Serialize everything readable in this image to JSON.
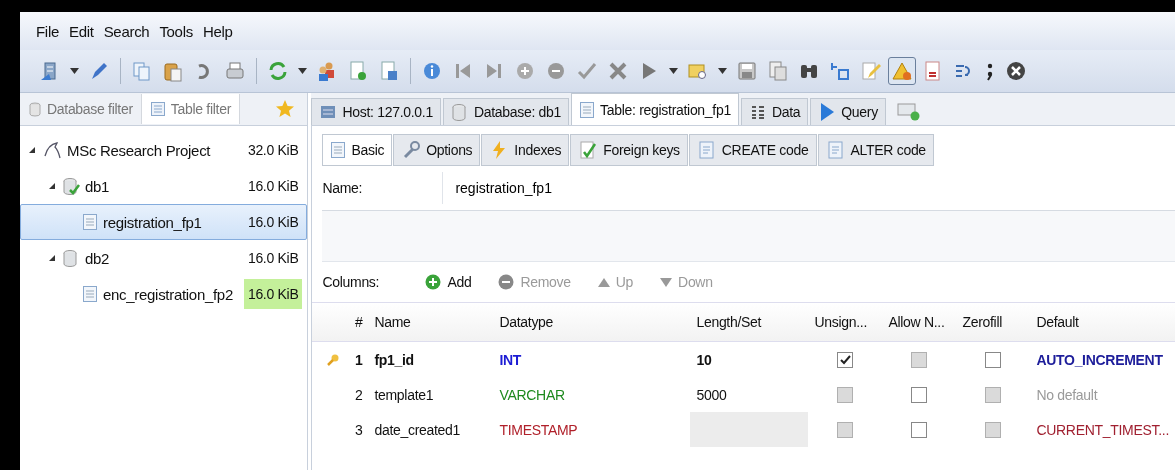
{
  "menu": [
    "File",
    "Edit",
    "Search",
    "Tools",
    "Help"
  ],
  "toolbar_buttons": [
    {
      "pressed": false
    },
    {
      "pressed": false
    },
    {
      "pressed": false
    },
    {
      "pressed": false
    },
    {
      "pressed": false
    },
    {
      "pressed": false
    },
    {
      "pressed": false
    },
    {
      "pressed": false
    },
    {
      "pressed": false
    },
    {
      "pressed": false
    },
    {
      "pressed": false
    },
    {
      "pressed": false
    },
    {
      "pressed": false
    },
    {
      "pressed": false
    },
    {
      "pressed": false
    },
    {
      "pressed": false
    },
    {
      "pressed": false
    },
    {
      "pressed": false
    },
    {
      "pressed": false
    },
    {
      "pressed": false
    },
    {
      "pressed": false
    },
    {
      "pressed": false
    },
    {
      "pressed": false
    },
    {
      "pressed": false
    },
    {
      "pressed": false
    },
    {
      "pressed": false
    },
    {
      "pressed": false
    },
    {
      "pressed": false
    },
    {
      "pressed": true
    },
    {
      "pressed": false
    },
    {
      "pressed": false
    },
    {
      "pressed": false
    },
    {
      "pressed": false
    }
  ],
  "filter_tabs": [
    {
      "label": "Database filter",
      "kind": "database",
      "selected": false
    },
    {
      "label": "Table filter",
      "kind": "table",
      "selected": true
    }
  ],
  "tree": [
    {
      "label": "MSc Research Project",
      "size": "32.0 KiB",
      "kind": "server",
      "expanded": true,
      "selected": false,
      "size_highlighted": false,
      "children": [
        {
          "label": "db1",
          "size": "16.0 KiB",
          "kind": "database-active",
          "expanded": true,
          "selected": false,
          "size_highlighted": false,
          "children": [
            {
              "label": "registration_fp1",
              "size": "16.0 KiB",
              "kind": "table",
              "selected": true,
              "size_highlighted": false
            }
          ]
        },
        {
          "label": "db2",
          "size": "16.0 KiB",
          "kind": "database",
          "expanded": true,
          "selected": false,
          "size_highlighted": false,
          "children": [
            {
              "label": "enc_registration_fp2",
              "size": "16.0 KiB",
              "kind": "table",
              "selected": false,
              "size_highlighted": true
            }
          ]
        }
      ]
    }
  ],
  "tabs": [
    {
      "label": "Host: 127.0.0.1",
      "kind": "host",
      "selected": false
    },
    {
      "label": "Database: db1",
      "kind": "database",
      "selected": false
    },
    {
      "label": "Table: registration_fp1",
      "kind": "table",
      "selected": true
    },
    {
      "label": "Data",
      "kind": "data",
      "selected": false
    },
    {
      "label": "Query",
      "kind": "query",
      "selected": false
    }
  ],
  "editor_tabs": [
    {
      "label": "Basic",
      "kind": "basic",
      "selected": true
    },
    {
      "label": "Options",
      "kind": "options",
      "selected": false
    },
    {
      "label": "Indexes",
      "kind": "indexes",
      "selected": false
    },
    {
      "label": "Foreign keys",
      "kind": "foreign",
      "selected": false
    },
    {
      "label": "CREATE code",
      "kind": "code",
      "selected": false
    },
    {
      "label": "ALTER code",
      "kind": "code",
      "selected": false
    }
  ],
  "name_field": {
    "label": "Name:",
    "value": "registration_fp1"
  },
  "columns_toolbar": {
    "label": "Columns:",
    "buttons": [
      {
        "label": "Add",
        "kind": "add",
        "disabled": false
      },
      {
        "label": "Remove",
        "kind": "remove",
        "disabled": true
      },
      {
        "label": "Up",
        "kind": "up",
        "disabled": true
      },
      {
        "label": "Down",
        "kind": "down",
        "disabled": true
      }
    ]
  },
  "table": {
    "columns": [
      "#",
      "Name",
      "Datatype",
      "Length/Set",
      "Unsign...",
      "Allow N...",
      "Zerofill",
      "Default"
    ],
    "rows": [
      {
        "number": "1",
        "name": "fp1_id",
        "datatype": "INT",
        "color": "#1c1cd4",
        "length": "10",
        "length_disabled": false,
        "primary_key": true,
        "unsigned": {
          "checked": true,
          "disabled": false
        },
        "allow_null": {
          "checked": false,
          "disabled": true
        },
        "zerofill": {
          "checked": false,
          "disabled": false
        },
        "default": {
          "text": "AUTO_INCREMENT",
          "color": "#1d1d9a"
        }
      },
      {
        "number": "2",
        "name": "template1",
        "datatype": "VARCHAR",
        "color": "#1e8a1e",
        "length": "5000",
        "length_disabled": false,
        "primary_key": false,
        "unsigned": {
          "checked": false,
          "disabled": true
        },
        "allow_null": {
          "checked": false,
          "disabled": false
        },
        "zerofill": {
          "checked": false,
          "disabled": true
        },
        "default": {
          "text": "No default",
          "color": "#9a9a9a"
        }
      },
      {
        "number": "3",
        "name": "date_created1",
        "datatype": "TIMESTAMP",
        "color": "#b0202a",
        "length_disabled": true,
        "primary_key": false,
        "unsigned": {
          "checked": false,
          "disabled": true
        },
        "allow_null": {
          "checked": false,
          "disabled": false
        },
        "zerofill": {
          "checked": false,
          "disabled": true
        },
        "default": {
          "text": "CURRENT_TIMEST...",
          "color": "#a02030"
        }
      }
    ]
  }
}
